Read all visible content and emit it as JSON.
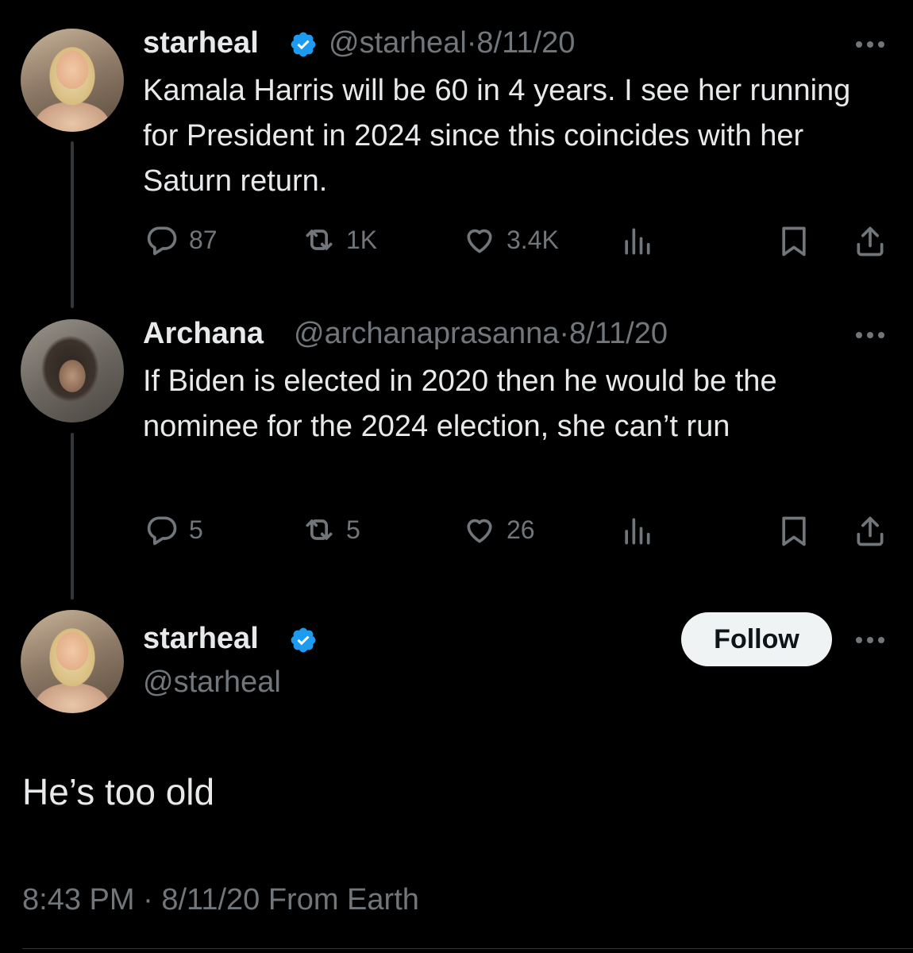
{
  "tweets": [
    {
      "display_name": "starheal",
      "handle": "@starheal",
      "date": "8/11/20",
      "verified": true,
      "text": "Kamala Harris will be 60 in 4 years. I see her running for President in 2024 since this coincides with her Saturn return.",
      "replies": "87",
      "reposts": "1K",
      "likes": "3.4K"
    },
    {
      "display_name": "Archana",
      "handle": "@archanaprasanna",
      "date": "8/11/20",
      "verified": false,
      "text": "If Biden is elected in 2020 then he would be the nominee for the 2024 election, she can’t run",
      "replies": "5",
      "reposts": "5",
      "likes": "26"
    }
  ],
  "main_tweet": {
    "display_name": "starheal",
    "handle": "@starheal",
    "verified": true,
    "follow_label": "Follow",
    "text": "He’s too old",
    "time": "8:43 PM",
    "date": "8/11/20",
    "source": "From Earth"
  },
  "colors": {
    "background": "#000000",
    "text_primary": "#e7e9ea",
    "text_secondary": "#71767b",
    "verified_blue": "#1d9bf0",
    "follow_bg": "#eff3f4"
  },
  "icons": [
    "reply-icon",
    "repost-icon",
    "like-icon",
    "views-icon",
    "bookmark-icon",
    "share-icon",
    "more-icon",
    "verified-badge-icon"
  ]
}
